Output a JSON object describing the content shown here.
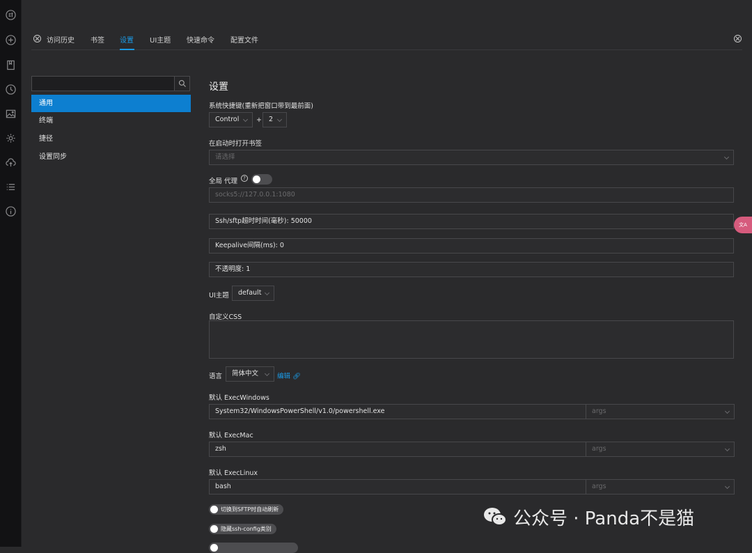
{
  "tabs": [
    {
      "label": "访问历史",
      "active": false
    },
    {
      "label": "书签",
      "active": false
    },
    {
      "label": "设置",
      "active": true
    },
    {
      "label": "UI主题",
      "active": false
    },
    {
      "label": "快速命令",
      "active": false
    },
    {
      "label": "配置文件",
      "active": false
    }
  ],
  "sidebar": {
    "search_value": "",
    "items": [
      {
        "label": "通用",
        "active": true
      },
      {
        "label": "终端",
        "active": false
      },
      {
        "label": "捷径",
        "active": false
      },
      {
        "label": "设置同步",
        "active": false
      }
    ]
  },
  "settings": {
    "title": "设置",
    "hotkey_label": "系统快捷键(重新把窗口带到最前面)",
    "hotkey_modifier": "Control",
    "hotkey_plus": "+",
    "hotkey_key": "2",
    "startup_bookmarks_label": "在启动时打开书签",
    "startup_bookmarks_placeholder": "请选择",
    "proxy_label": "全局 代理",
    "proxy_help": "?",
    "proxy_placeholder": "socks5://127.0.0.1:1080",
    "ssh_timeout": "Ssh/sftp超时时间(毫秒): 50000",
    "keepalive": "Keepalive间隔(ms): 0",
    "opacity": "不透明度: 1",
    "ui_theme_label": "UI主题",
    "ui_theme_value": "default",
    "custom_css_label": "自定义CSS",
    "language_label": "语言",
    "language_value": "简体中文",
    "language_edit": "编辑",
    "exec_windows_label": "默认 ExecWindows",
    "exec_windows_value": "System32/WindowsPowerShell/v1.0/powershell.exe",
    "exec_windows_args": "args",
    "exec_mac_label": "默认 ExecMac",
    "exec_mac_value": "zsh",
    "exec_mac_args": "args",
    "exec_linux_label": "默认 ExecLinux",
    "exec_linux_value": "bash",
    "exec_linux_args": "args",
    "switch_sftp_label": "切换到SFTP时自动刷新",
    "switch_ssh_config_label": "隐藏ssh-config类别"
  },
  "translate_badge": "文A",
  "watermark": "公众号 · Panda不是猫",
  "colors": {
    "accent": "#1a9ae6",
    "sidebar_active": "#0d7fd0",
    "background": "#2a2a2c",
    "rail": "#121214"
  }
}
